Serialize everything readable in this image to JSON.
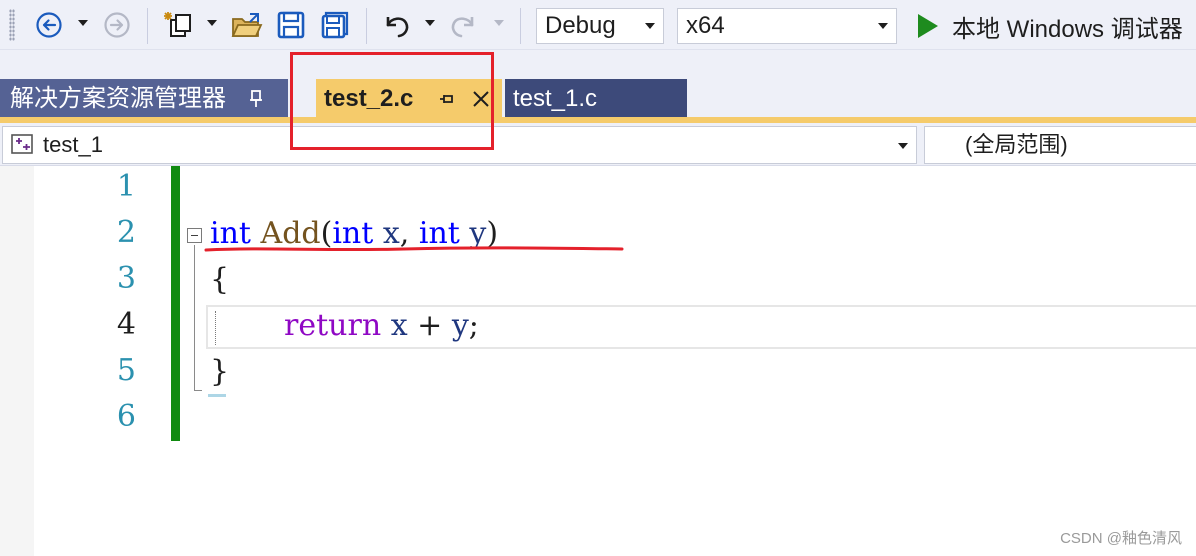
{
  "toolbar": {
    "icons": [
      "back-icon",
      "forward-icon",
      "new-project-icon",
      "open-folder-icon",
      "save-icon",
      "save-all-icon",
      "undo-icon",
      "redo-icon"
    ],
    "configuration": "Debug",
    "platform": "x64",
    "run_label": "本地 Windows 调试器"
  },
  "tabs": {
    "solution_explorer": "解决方案资源管理器",
    "active_file": "test_2.c",
    "other_file": "test_1.c"
  },
  "navbar": {
    "project": "test_1",
    "scope": "(全局范围)"
  },
  "editor": {
    "line_numbers": [
      "1",
      "2",
      "3",
      "4",
      "5",
      "6"
    ],
    "current_line": 4,
    "code": {
      "line2_kw1": "int",
      "line2_fn": "Add",
      "line2_open": "(",
      "line2_kw2": "int",
      "line2_p1": "x",
      "line2_comma": ", ",
      "line2_kw3": "int",
      "line2_p2": "y",
      "line2_close": ")",
      "line3": "{",
      "line4_kw": "return",
      "line4_a": "x",
      "line4_op": " + ",
      "line4_b": "y",
      "line4_end": ";",
      "line5": "}"
    }
  },
  "colors": {
    "toolbar_bg": "#eef0f8",
    "active_tab": "#f5cb6b",
    "inactive_tab": "#3d4a7a",
    "change_bar": "#108a10",
    "annotation_red": "#e4212b",
    "keyword": "#0000ff",
    "control_keyword": "#8f08c4"
  },
  "watermark": "CSDN @釉色清风"
}
